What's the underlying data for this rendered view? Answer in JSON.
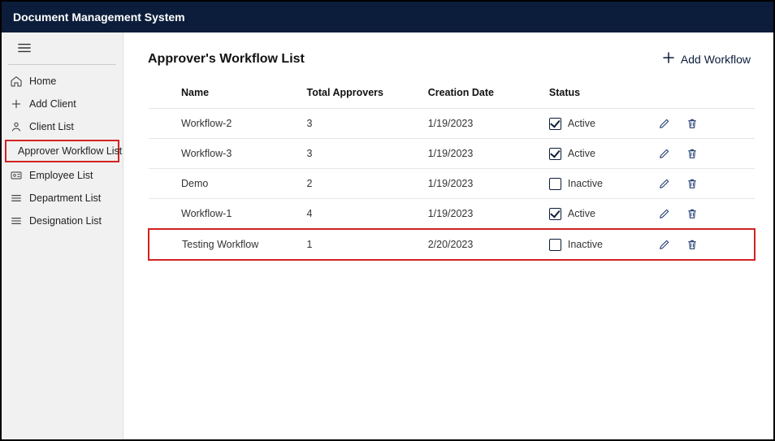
{
  "app_title": "Document Management System",
  "sidebar": {
    "items": [
      {
        "id": "home",
        "label": "Home",
        "icon": "home-icon"
      },
      {
        "id": "add-client",
        "label": "Add Client",
        "icon": "plus-icon"
      },
      {
        "id": "client",
        "label": "Client List",
        "icon": "person-icon"
      },
      {
        "id": "approver",
        "label": "Approver Workflow List",
        "icon": "workflow-icon",
        "highlighted": true
      },
      {
        "id": "employee",
        "label": "Employee List",
        "icon": "id-card-icon"
      },
      {
        "id": "department",
        "label": "Department List",
        "icon": "list-icon"
      },
      {
        "id": "designation",
        "label": "Designation List",
        "icon": "list-icon"
      }
    ]
  },
  "page": {
    "title": "Approver's Workflow List",
    "add_button_label": "Add Workflow"
  },
  "table": {
    "columns": {
      "name": "Name",
      "total": "Total Approvers",
      "date": "Creation Date",
      "status": "Status"
    },
    "status_labels": {
      "active": "Active",
      "inactive": "Inactive"
    },
    "rows": [
      {
        "name": "Workflow-2",
        "total": "3",
        "date": "1/19/2023",
        "active": true,
        "highlighted": false
      },
      {
        "name": "Workflow-3",
        "total": "3",
        "date": "1/19/2023",
        "active": true,
        "highlighted": false
      },
      {
        "name": "Demo",
        "total": "2",
        "date": "1/19/2023",
        "active": false,
        "highlighted": false
      },
      {
        "name": "Workflow-1",
        "total": "4",
        "date": "1/19/2023",
        "active": true,
        "highlighted": false
      },
      {
        "name": "Testing Workflow",
        "total": "1",
        "date": "2/20/2023",
        "active": false,
        "highlighted": true
      }
    ]
  },
  "colors": {
    "brand": "#0b1d3a",
    "highlight_border": "#d22222",
    "icon_action": "#1f3a6e"
  }
}
